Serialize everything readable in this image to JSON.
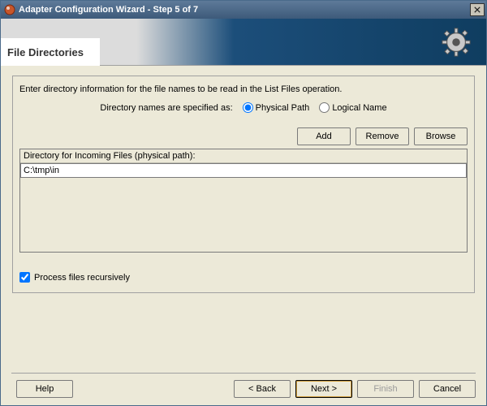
{
  "window": {
    "title": "Adapter Configuration Wizard - Step 5 of 7"
  },
  "banner": {
    "heading": "File Directories"
  },
  "group": {
    "instruction": "Enter directory information for the file names to be read in the List Files operation.",
    "radio_label": "Directory names are specified as:",
    "radio_physical": "Physical Path",
    "radio_logical": "Logical Name",
    "radio_selected": "physical",
    "buttons": {
      "add": "Add",
      "remove": "Remove",
      "browse": "Browse"
    },
    "list_header": "Directory for Incoming Files (physical path):",
    "directory_value": "C:\\tmp\\in",
    "recursive_label": "Process files recursively",
    "recursive_checked": true
  },
  "footer": {
    "help": "Help",
    "back": "< Back",
    "next": "Next >",
    "finish": "Finish",
    "cancel": "Cancel"
  }
}
